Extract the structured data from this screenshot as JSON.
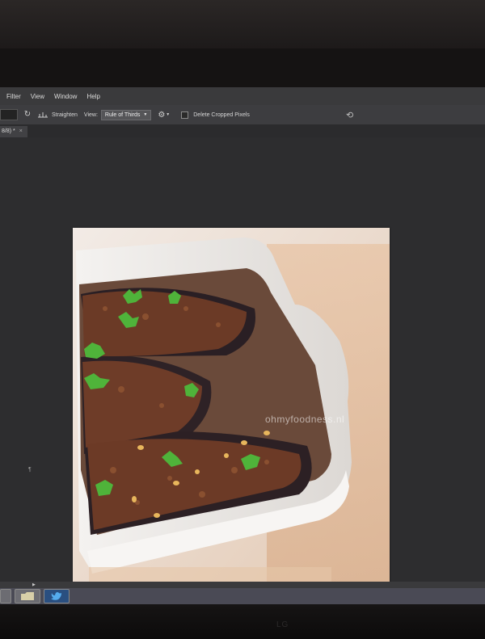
{
  "menubar": {
    "items": [
      "Filter",
      "View",
      "Window",
      "Help"
    ]
  },
  "options_bar": {
    "straighten_label": "Straighten",
    "view_label": "View:",
    "view_value": "Rule of Thirds",
    "delete_cropped_label": "Delete Cropped Pixels",
    "delete_cropped_checked": false
  },
  "tab": {
    "label": "8/8) *",
    "close": "×"
  },
  "photo": {
    "watermark": "ohmyfoodness.nl"
  },
  "icons": {
    "rotate": "rotate-icon",
    "straighten": "straighten-icon",
    "gear": "gear-icon",
    "undo": "undo-icon",
    "twitter": "twitter-icon",
    "folder": "folder-icon"
  },
  "monitor": {
    "brand": "LG"
  }
}
